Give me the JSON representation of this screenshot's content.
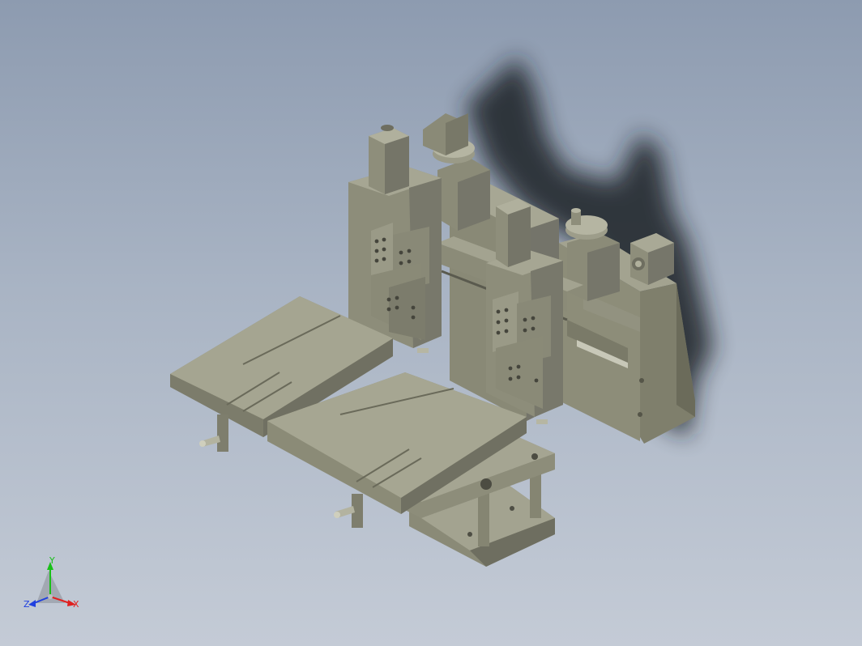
{
  "viewport": {
    "background_top": "#8d9bb0",
    "background_bottom": "#c4cbd6",
    "model_color": "#8a8a78",
    "shadow_color": "#1e2226"
  },
  "triad": {
    "x_label": "X",
    "y_label": "Y",
    "z_label": "Z",
    "x_color": "#e02020",
    "y_color": "#18c018",
    "z_color": "#2040e0"
  }
}
